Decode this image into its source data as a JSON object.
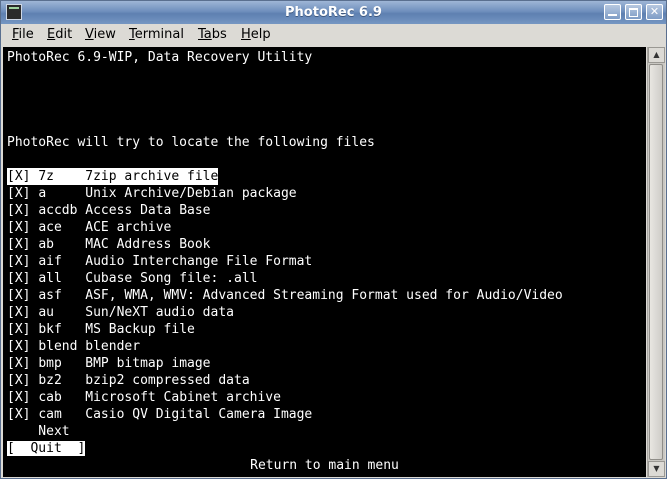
{
  "window": {
    "title": "PhotoRec 6.9"
  },
  "menu": {
    "items": [
      {
        "mnemonic": "F",
        "rest": "ile"
      },
      {
        "mnemonic": "E",
        "rest": "dit"
      },
      {
        "mnemonic": "V",
        "rest": "iew"
      },
      {
        "mnemonic": "T",
        "rest": "erminal"
      },
      {
        "mnemonic": "Ta",
        "rest": "bs"
      },
      {
        "mnemonic": "H",
        "rest": "elp"
      }
    ]
  },
  "terminal": {
    "header": "PhotoRec 6.9-WIP, Data Recovery Utility",
    "intro": "PhotoRec will try to locate the following files",
    "files": [
      {
        "mark": "[X]",
        "ext": "7z   ",
        "desc": "7zip archive file"
      },
      {
        "mark": "[X]",
        "ext": "a    ",
        "desc": "Unix Archive/Debian package"
      },
      {
        "mark": "[X]",
        "ext": "accdb",
        "desc": "Access Data Base"
      },
      {
        "mark": "[X]",
        "ext": "ace  ",
        "desc": "ACE archive"
      },
      {
        "mark": "[X]",
        "ext": "ab   ",
        "desc": "MAC Address Book"
      },
      {
        "mark": "[X]",
        "ext": "aif  ",
        "desc": "Audio Interchange File Format"
      },
      {
        "mark": "[X]",
        "ext": "all  ",
        "desc": "Cubase Song file: .all"
      },
      {
        "mark": "[X]",
        "ext": "asf  ",
        "desc": "ASF, WMA, WMV: Advanced Streaming Format used for Audio/Video"
      },
      {
        "mark": "[X]",
        "ext": "au   ",
        "desc": "Sun/NeXT audio data"
      },
      {
        "mark": "[X]",
        "ext": "bkf  ",
        "desc": "MS Backup file"
      },
      {
        "mark": "[X]",
        "ext": "blend",
        "desc": "blender"
      },
      {
        "mark": "[X]",
        "ext": "bmp  ",
        "desc": "BMP bitmap image"
      },
      {
        "mark": "[X]",
        "ext": "bz2  ",
        "desc": "bzip2 compressed data"
      },
      {
        "mark": "[X]",
        "ext": "cab  ",
        "desc": "Microsoft Cabinet archive"
      },
      {
        "mark": "[X]",
        "ext": "cam  ",
        "desc": "Casio QV Digital Camera Image"
      }
    ],
    "next_label": "    Next",
    "quit_label": "[  Quit  ]",
    "footer": "Return to main menu"
  },
  "colors": {
    "terminal_bg": "#000000",
    "terminal_fg": "#ffffff",
    "highlight_bg": "#ffffff",
    "highlight_fg": "#000000"
  }
}
